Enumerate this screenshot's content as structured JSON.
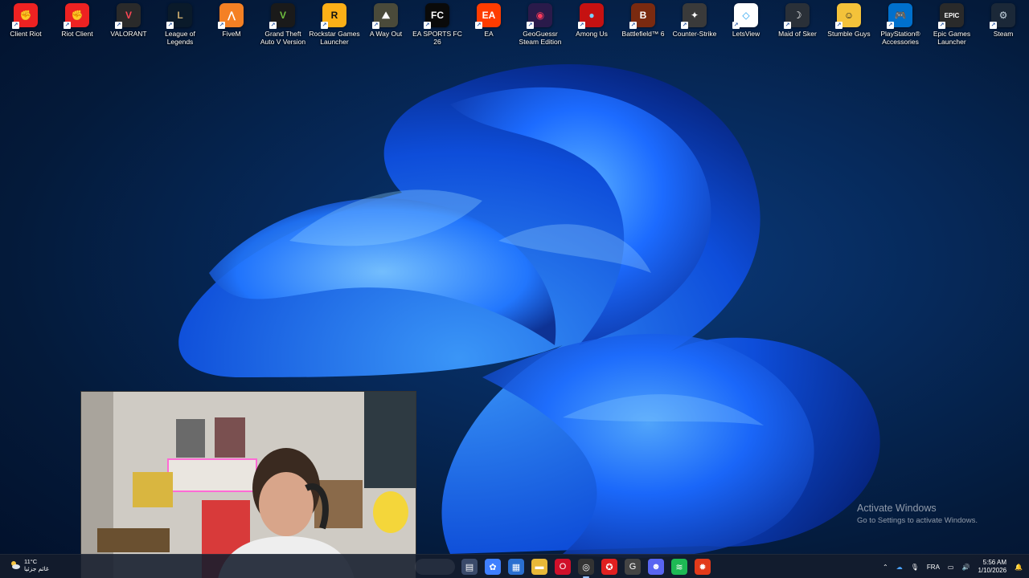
{
  "desktop_icons": [
    {
      "label": "Client Riot",
      "color": "#e22",
      "glyph": "✊"
    },
    {
      "label": "Riot Client",
      "color": "#e22",
      "glyph": "✊"
    },
    {
      "label": "VALORANT",
      "color": "#2a2a2a",
      "glyph": "V",
      "glyph_color": "#ff4655"
    },
    {
      "label": "League of Legends",
      "color": "#0a1a2a",
      "glyph": "L",
      "glyph_color": "#c8aa6e"
    },
    {
      "label": "FiveM",
      "color": "#f48024",
      "glyph": "⋀"
    },
    {
      "label": "Grand Theft Auto V Version origin...",
      "color": "#1a1a1a",
      "glyph": "V",
      "glyph_color": "#6fbf3f"
    },
    {
      "label": "Rockstar Games Launcher",
      "color": "#fcaf17",
      "glyph": "R",
      "glyph_color": "#111"
    },
    {
      "label": "A Way Out",
      "color": "#4a4a3a",
      "glyph": "⛰"
    },
    {
      "label": "EA SPORTS FC 26",
      "color": "#0a0a0a",
      "glyph": "FC"
    },
    {
      "label": "EA",
      "color": "#ff3c00",
      "glyph": "EA"
    },
    {
      "label": "GeoGuessr Steam Edition",
      "color": "#2a1a4a",
      "glyph": "◉",
      "glyph_color": "#ff3b5c"
    },
    {
      "label": "Among Us",
      "color": "#c51111",
      "glyph": "●",
      "glyph_color": "#7ad1ff"
    },
    {
      "label": "Battlefield™ 6",
      "color": "#7a2a10",
      "glyph": "B"
    },
    {
      "label": "Counter-Strike",
      "color": "#3a3a3a",
      "glyph": "✦"
    },
    {
      "label": "LetsView",
      "color": "#ffffff",
      "glyph": "◇",
      "glyph_color": "#21a0f0"
    },
    {
      "label": "Maid of Sker",
      "color": "#2a3038",
      "glyph": "☽"
    },
    {
      "label": "Stumble Guys",
      "color": "#f4c23a",
      "glyph": "☺",
      "glyph_color": "#222"
    },
    {
      "label": "PlayStation® Accessories",
      "color": "#0070cc",
      "glyph": "🎮"
    },
    {
      "label": "Epic Games Launcher",
      "color": "#2a2a2a",
      "glyph": "EPIC"
    },
    {
      "label": "Steam",
      "color": "#1b2838",
      "glyph": "⚙",
      "glyph_color": "#c7d5e0"
    }
  ],
  "activation": {
    "title": "Activate Windows",
    "subtitle": "Go to Settings to activate Windows."
  },
  "weather": {
    "temp": "11°C",
    "desc": "غائم جزئيا"
  },
  "taskbar_apps": [
    {
      "name": "file-icon",
      "glyph": "▤",
      "color": "#3a4a6a"
    },
    {
      "name": "copilot-icon",
      "glyph": "✿",
      "color": "#3f7fff"
    },
    {
      "name": "store-icon",
      "glyph": "▦",
      "color": "#2a6fd0"
    },
    {
      "name": "folder-icon",
      "glyph": "▬",
      "color": "#e8b838"
    },
    {
      "name": "opera-icon",
      "glyph": "O",
      "color": "#d0102a"
    },
    {
      "name": "chrome-icon",
      "glyph": "◎",
      "color": "#333"
    },
    {
      "name": "app-red-icon",
      "glyph": "✪",
      "color": "#e02020"
    },
    {
      "name": "g-app-icon",
      "glyph": "G",
      "color": "#444"
    },
    {
      "name": "discord-icon",
      "glyph": "☻",
      "color": "#5865f2"
    },
    {
      "name": "spotify-icon",
      "glyph": "≋",
      "color": "#1db954"
    },
    {
      "name": "app-orange-icon",
      "glyph": "✹",
      "color": "#e23a1a"
    }
  ],
  "tray": {
    "language": "FRA",
    "time": "5:56 AM",
    "date": "1/10/2026"
  }
}
